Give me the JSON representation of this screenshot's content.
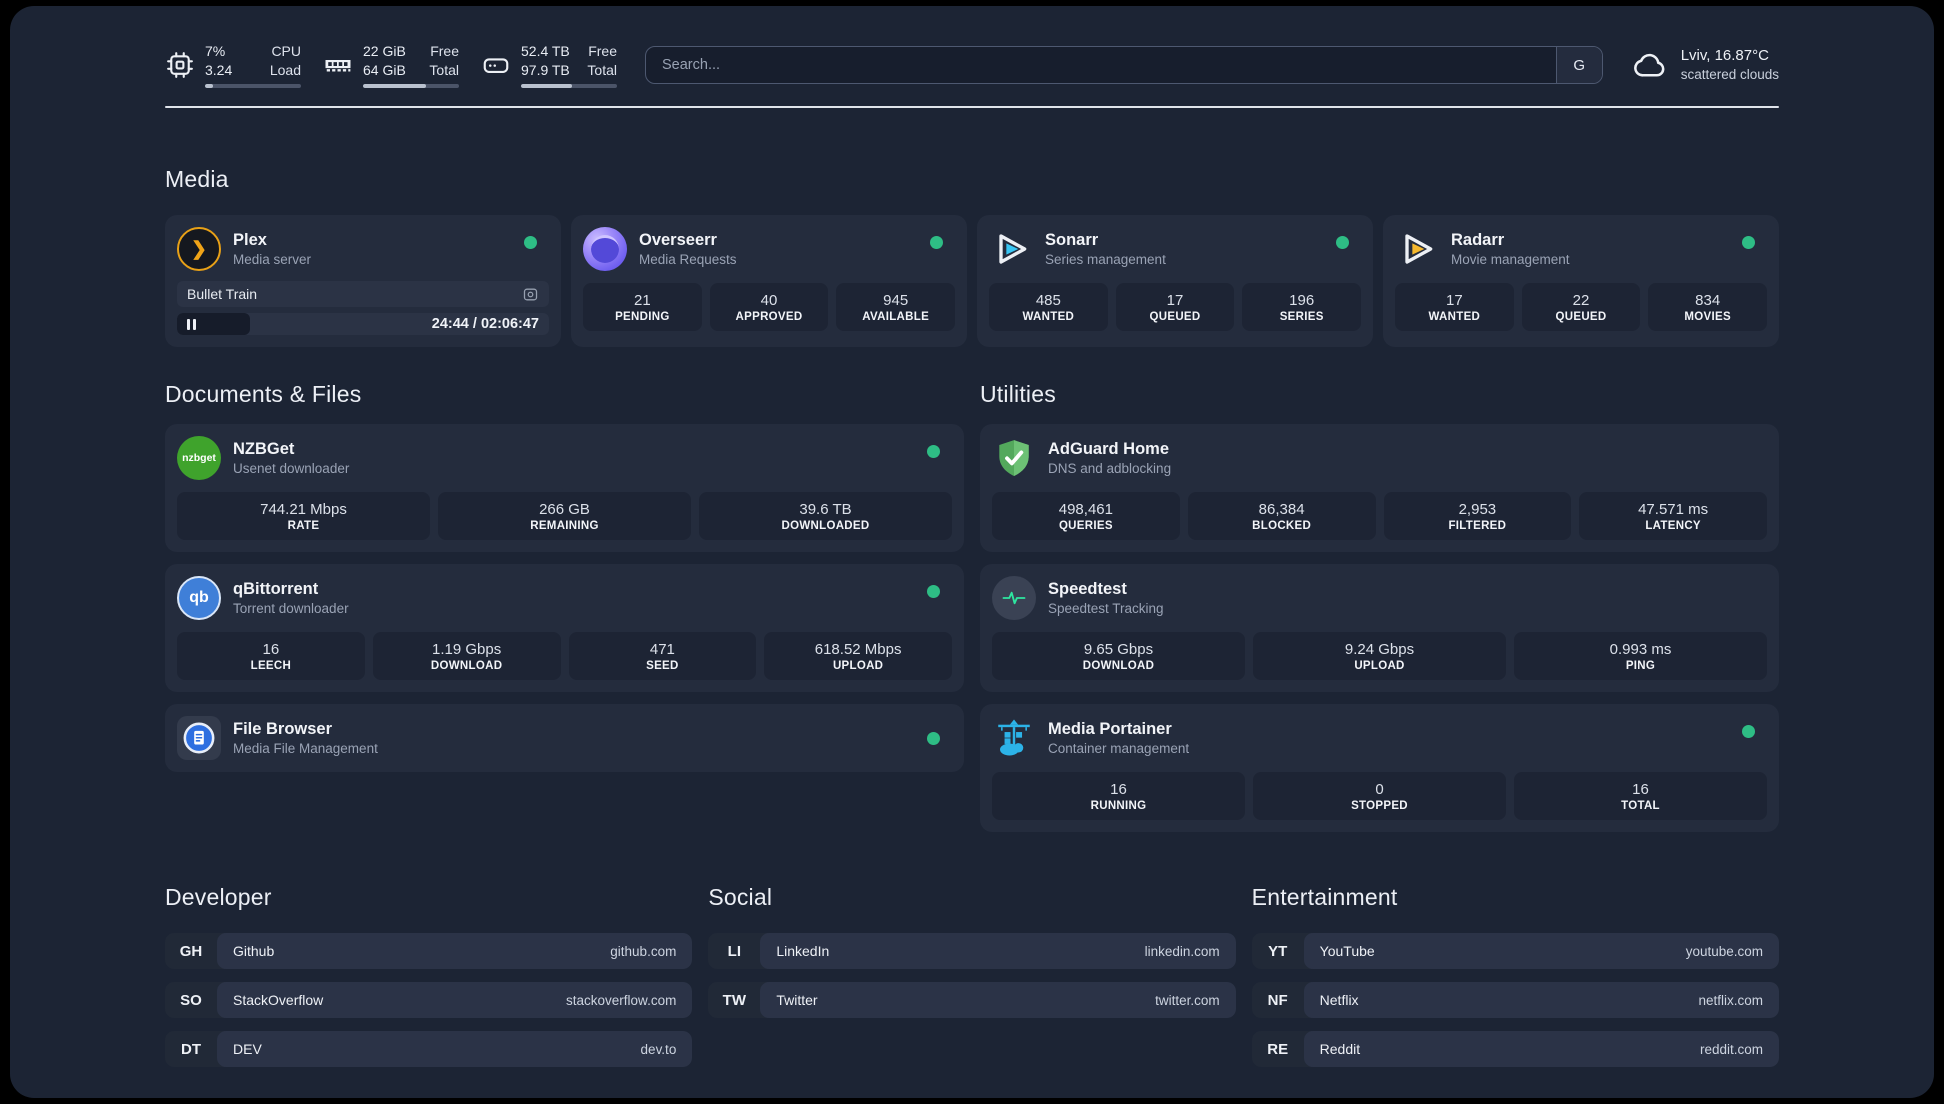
{
  "colors": {
    "status_online": "#2ebd85",
    "plex_amber": "#e8a117",
    "sonarr_blue": "#38c6f4",
    "radarr_yellow": "#f5b82e",
    "adguard_green": "#5eb766",
    "portainer_blue": "#2cb3e8",
    "qbittorrent_blue": "#3f7fd8",
    "nzbget_green": "#3fa32c",
    "overseerr_purple": "#6f5ff0"
  },
  "topbar": {
    "cpu": {
      "icon": "cpu-icon",
      "primary": "7%",
      "secondary": "3.24",
      "label_primary": "CPU",
      "label_secondary": "Load",
      "progress": 8
    },
    "memory": {
      "icon": "ram-icon",
      "primary": "22 GiB",
      "secondary": "64 GiB",
      "label_primary": "Free",
      "label_secondary": "Total",
      "progress": 66
    },
    "disk": {
      "icon": "disk-icon",
      "primary": "52.4 TB",
      "secondary": "97.9 TB",
      "label_primary": "Free",
      "label_secondary": "Total",
      "progress": 53
    },
    "search": {
      "placeholder": "Search...",
      "button": "G"
    },
    "weather": {
      "icon": "cloud-icon",
      "location": "Lviv, 16.87°C",
      "condition": "scattered clouds"
    }
  },
  "sections": {
    "media": "Media",
    "documents": "Documents & Files",
    "utilities": "Utilities",
    "developer": "Developer",
    "social": "Social",
    "entertainment": "Entertainment"
  },
  "apps": {
    "plex": {
      "name": "Plex",
      "subtitle": "Media server",
      "icon": "plex-icon",
      "online": true,
      "now_playing": {
        "title": "Bullet Train",
        "time": "24:44 / 02:06:47",
        "progress": 19.5
      }
    },
    "overseerr": {
      "name": "Overseerr",
      "subtitle": "Media Requests",
      "icon": "overseerr-icon",
      "online": true,
      "stats": [
        {
          "value": "21",
          "label": "PENDING"
        },
        {
          "value": "40",
          "label": "APPROVED"
        },
        {
          "value": "945",
          "label": "AVAILABLE"
        }
      ]
    },
    "sonarr": {
      "name": "Sonarr",
      "subtitle": "Series management",
      "icon": "sonarr-icon",
      "online": true,
      "stats": [
        {
          "value": "485",
          "label": "WANTED"
        },
        {
          "value": "17",
          "label": "QUEUED"
        },
        {
          "value": "196",
          "label": "SERIES"
        }
      ]
    },
    "radarr": {
      "name": "Radarr",
      "subtitle": "Movie management",
      "icon": "radarr-icon",
      "online": true,
      "stats": [
        {
          "value": "17",
          "label": "WANTED"
        },
        {
          "value": "22",
          "label": "QUEUED"
        },
        {
          "value": "834",
          "label": "MOVIES"
        }
      ]
    },
    "nzbget": {
      "name": "NZBGet",
      "subtitle": "Usenet downloader",
      "icon": "nzbget-icon",
      "icon_text": "nzbget",
      "online": true,
      "stats": [
        {
          "value": "744.21 Mbps",
          "label": "RATE"
        },
        {
          "value": "266 GB",
          "label": "REMAINING"
        },
        {
          "value": "39.6 TB",
          "label": "DOWNLOADED"
        }
      ]
    },
    "qbittorrent": {
      "name": "qBittorrent",
      "subtitle": "Torrent downloader",
      "icon": "qbittorrent-icon",
      "icon_text": "qb",
      "online": true,
      "stats": [
        {
          "value": "16",
          "label": "LEECH"
        },
        {
          "value": "1.19 Gbps",
          "label": "DOWNLOAD"
        },
        {
          "value": "471",
          "label": "SEED"
        },
        {
          "value": "618.52 Mbps",
          "label": "UPLOAD"
        }
      ]
    },
    "filebrowser": {
      "name": "File Browser",
      "subtitle": "Media File Management",
      "icon": "filebrowser-icon",
      "online": true
    },
    "adguard": {
      "name": "AdGuard Home",
      "subtitle": "DNS and adblocking",
      "icon": "adguard-icon",
      "online": true,
      "stats": [
        {
          "value": "498,461",
          "label": "QUERIES"
        },
        {
          "value": "86,384",
          "label": "BLOCKED"
        },
        {
          "value": "2,953",
          "label": "FILTERED"
        },
        {
          "value": "47.571 ms",
          "label": "LATENCY"
        }
      ]
    },
    "speedtest": {
      "name": "Speedtest",
      "subtitle": "Speedtest Tracking",
      "icon": "speedtest-icon",
      "online": true,
      "stats": [
        {
          "value": "9.65 Gbps",
          "label": "DOWNLOAD"
        },
        {
          "value": "9.24 Gbps",
          "label": "UPLOAD"
        },
        {
          "value": "0.993 ms",
          "label": "PING"
        }
      ]
    },
    "portainer": {
      "name": "Media Portainer",
      "subtitle": "Container management",
      "icon": "portainer-icon",
      "online": true,
      "stats": [
        {
          "value": "16",
          "label": "RUNNING"
        },
        {
          "value": "0",
          "label": "STOPPED"
        },
        {
          "value": "16",
          "label": "TOTAL"
        }
      ]
    }
  },
  "links": {
    "developer": [
      {
        "abbr": "GH",
        "name": "Github",
        "url": "github.com"
      },
      {
        "abbr": "SO",
        "name": "StackOverflow",
        "url": "stackoverflow.com"
      },
      {
        "abbr": "DT",
        "name": "DEV",
        "url": "dev.to"
      }
    ],
    "social": [
      {
        "abbr": "LI",
        "name": "LinkedIn",
        "url": "linkedin.com"
      },
      {
        "abbr": "TW",
        "name": "Twitter",
        "url": "twitter.com"
      }
    ],
    "entertainment": [
      {
        "abbr": "YT",
        "name": "YouTube",
        "url": "youtube.com"
      },
      {
        "abbr": "NF",
        "name": "Netflix",
        "url": "netflix.com"
      },
      {
        "abbr": "RE",
        "name": "Reddit",
        "url": "reddit.com"
      }
    ]
  }
}
